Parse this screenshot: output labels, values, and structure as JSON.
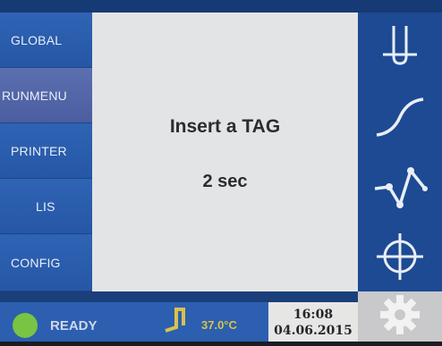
{
  "left_menu": {
    "items": [
      {
        "label": "GLOBAL"
      },
      {
        "label": "RUNMENU"
      },
      {
        "label": "PRINTER"
      },
      {
        "label": "LIS"
      },
      {
        "label": "CONFIG"
      }
    ],
    "active_index": 1
  },
  "main": {
    "message": "Insert a TAG",
    "timer": "2 sec"
  },
  "right_icons": [
    "tube-icon",
    "curve-icon",
    "graph-icon",
    "crosshair-icon"
  ],
  "status": {
    "state": "READY",
    "temperature": "37.0°C",
    "time": "16:08",
    "date": "04.06.2015"
  },
  "colors": {
    "accent": "#2a5aa8",
    "active_menu": "#5b6fb0",
    "ready": "#79c442",
    "temperature": "#d9c24a"
  }
}
